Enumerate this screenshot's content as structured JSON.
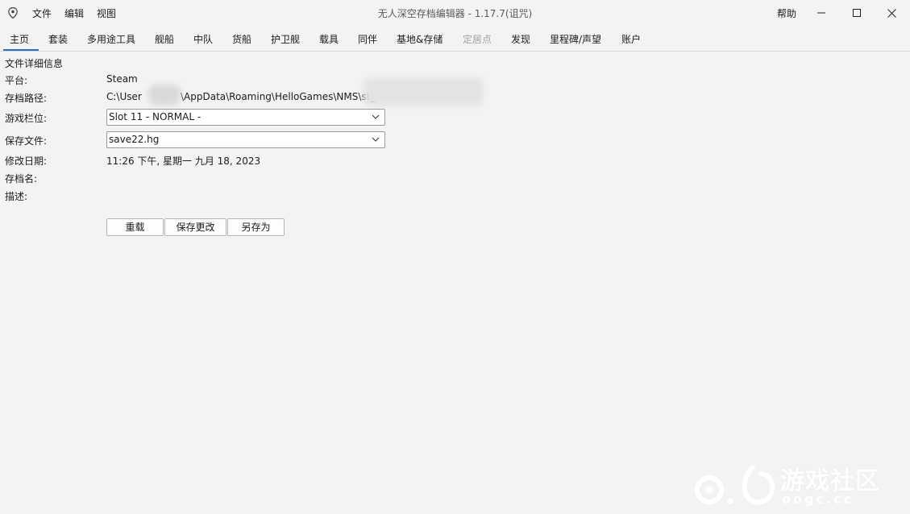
{
  "window": {
    "title": "无人深空存档编辑器 - 1.17.7(诅咒)",
    "menu": [
      "文件",
      "编辑",
      "视图"
    ],
    "help_label": "帮助",
    "controls": [
      "minimize",
      "maximize",
      "close"
    ]
  },
  "tabs": [
    {
      "label": "主页",
      "active": true
    },
    {
      "label": "套装"
    },
    {
      "label": "多用途工具"
    },
    {
      "label": "舰船"
    },
    {
      "label": "中队"
    },
    {
      "label": "货船"
    },
    {
      "label": "护卫舰"
    },
    {
      "label": "载具"
    },
    {
      "label": "同伴"
    },
    {
      "label": "基地&存储"
    },
    {
      "label": "定居点",
      "disabled": true
    },
    {
      "label": "发现"
    },
    {
      "label": "里程碑/声望"
    },
    {
      "label": "账户"
    }
  ],
  "file_info": {
    "section_title": "文件详细信息",
    "platform_label": "平台:",
    "platform_value": "Steam",
    "path_label": "存档路径:",
    "path_part1": "C:\\User",
    "path_part2": "\\AppData\\Roaming\\HelloGames\\NMS\\st_",
    "slot_label": "游戏栏位:",
    "slot_value": "Slot 11 - NORMAL -",
    "file_label": "保存文件:",
    "file_value": "save22.hg",
    "modified_label": "修改日期:",
    "modified_value": "11:26 下午, 星期一 九月 18, 2023",
    "name_label": "存档名:",
    "desc_label": "描述:"
  },
  "actions": {
    "reload": "重载",
    "save": "保存更改",
    "save_as": "另存为"
  },
  "watermark": {
    "text": "游戏社区",
    "sub": "oogc.cc"
  },
  "colors": {
    "accent": "#2b6cc4",
    "background": "#f3f3f3"
  }
}
